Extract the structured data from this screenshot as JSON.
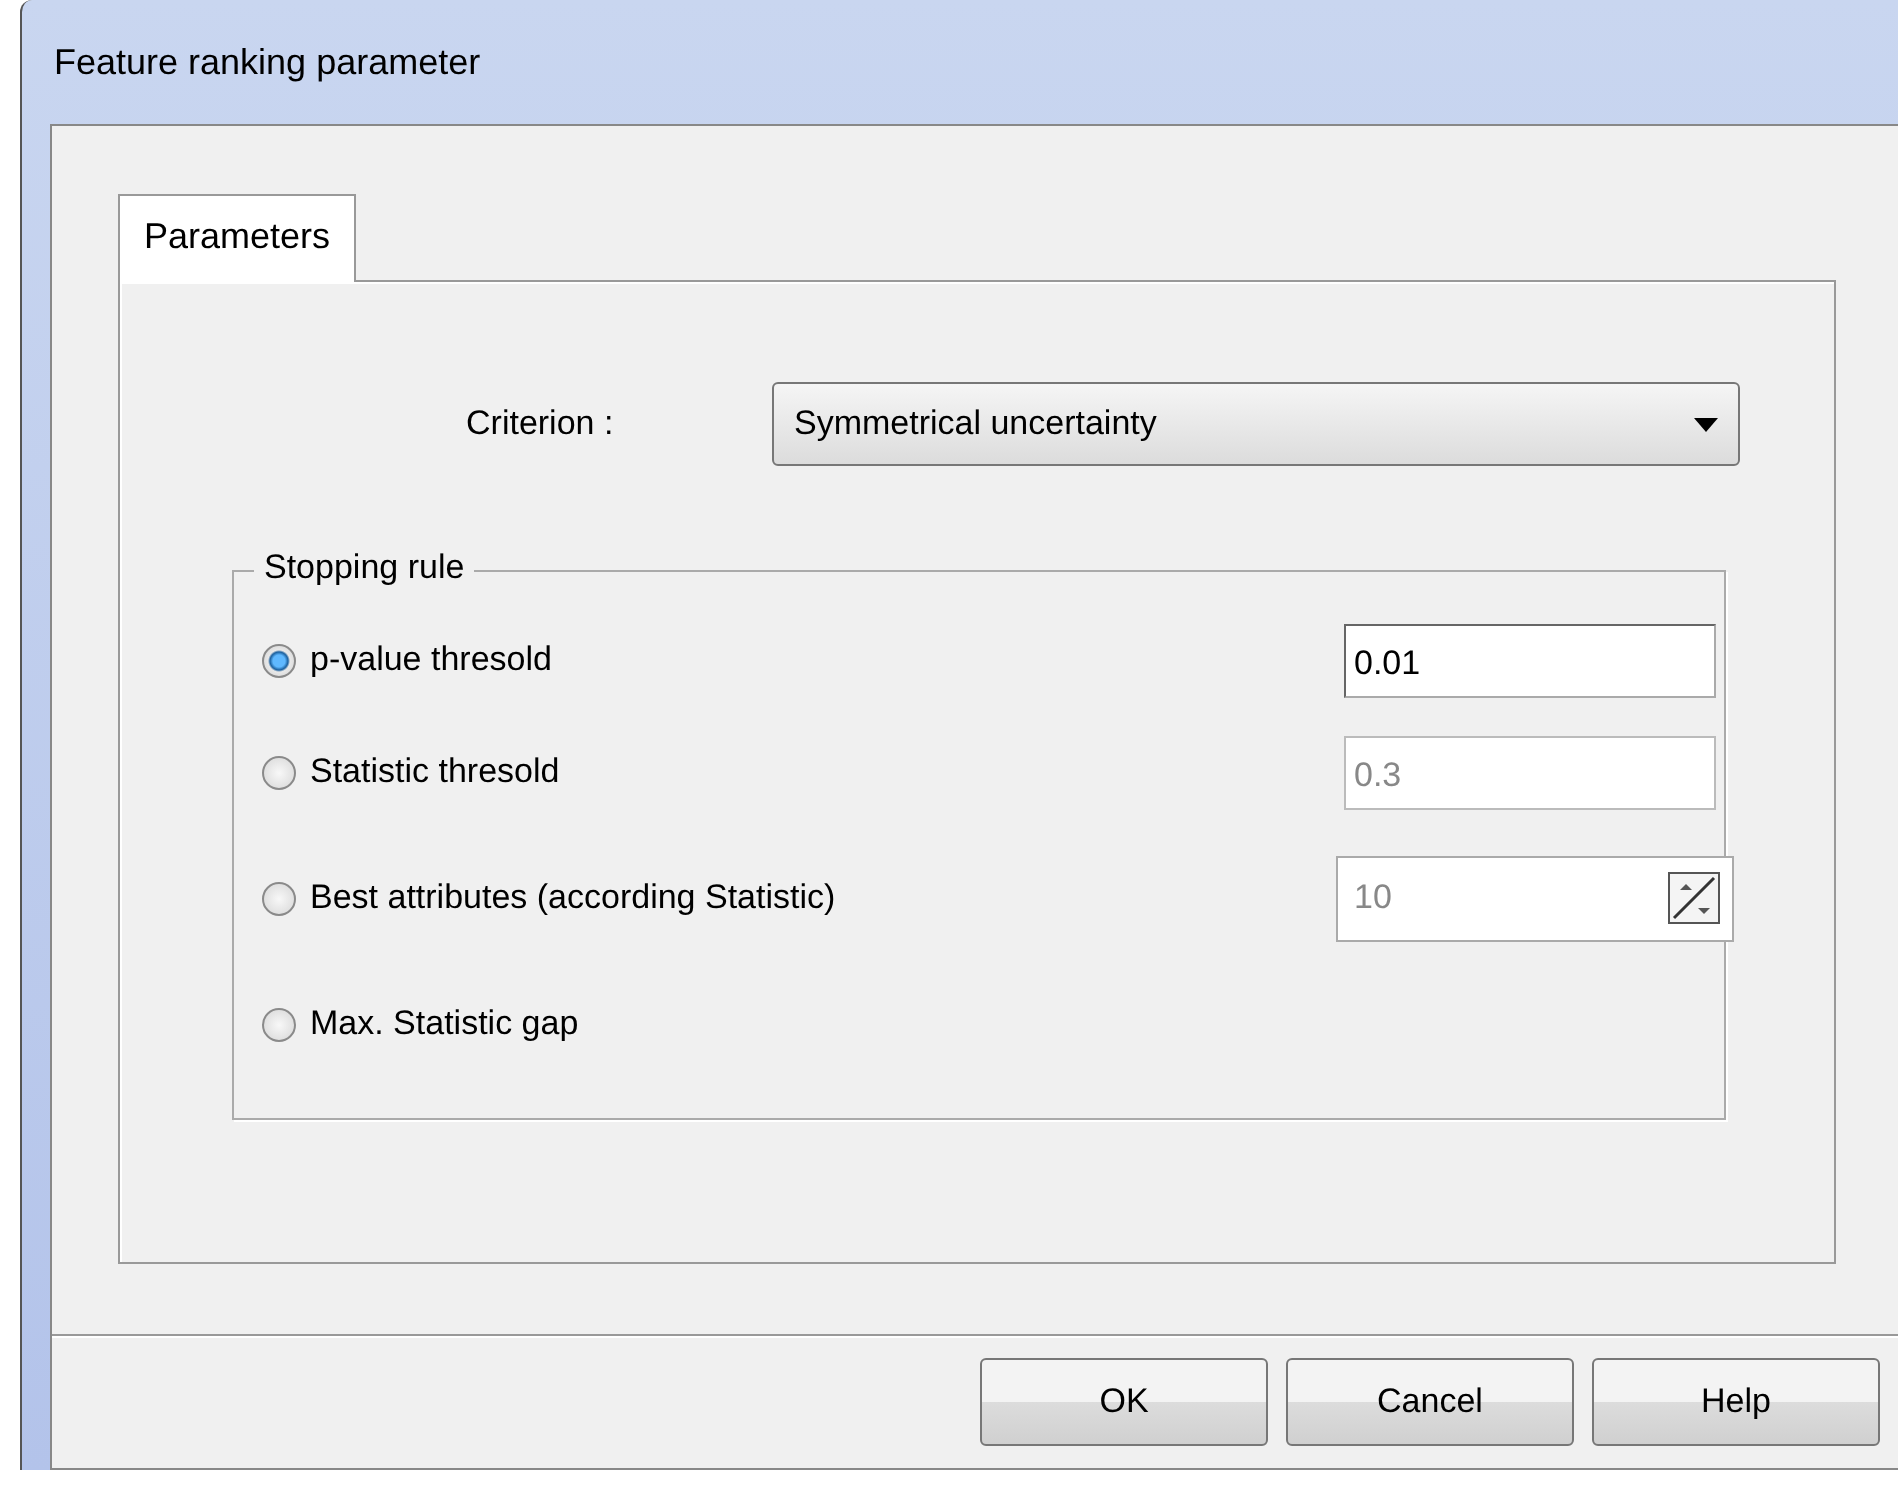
{
  "window": {
    "title": "Feature ranking parameter"
  },
  "tabs": [
    {
      "label": "Parameters",
      "selected": true
    }
  ],
  "criterion": {
    "label": "Criterion :",
    "value": "Symmetrical uncertainty"
  },
  "stopping_rule": {
    "title": "Stopping rule",
    "options": [
      {
        "label": "p-value thresold",
        "selected": true,
        "field": {
          "kind": "text",
          "value": "0.01",
          "disabled": false
        }
      },
      {
        "label": "Statistic thresold",
        "selected": false,
        "field": {
          "kind": "text",
          "value": "0.3",
          "disabled": true
        }
      },
      {
        "label": "Best attributes (according Statistic)",
        "selected": false,
        "field": {
          "kind": "spin",
          "value": "10",
          "disabled": true
        }
      },
      {
        "label": "Max. Statistic gap",
        "selected": false
      }
    ]
  },
  "buttons": [
    "OK",
    "Cancel",
    "Help"
  ]
}
